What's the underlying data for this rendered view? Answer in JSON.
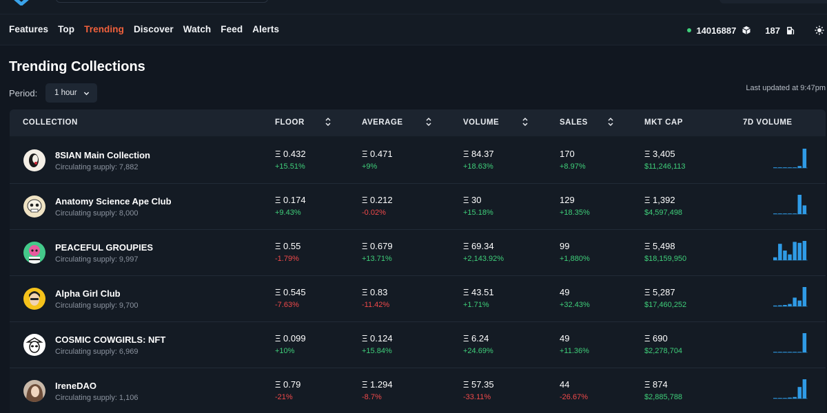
{
  "nav": {
    "items": [
      "Features",
      "Top",
      "Trending",
      "Discover",
      "Watch",
      "Feed",
      "Alerts"
    ],
    "active_index": 2
  },
  "header_stats": {
    "block_number": "14016887",
    "gas": "187"
  },
  "page": {
    "title": "Trending Collections",
    "period_label": "Period:",
    "period_value": "1 hour",
    "last_updated": "Last updated at 9:47pm"
  },
  "table": {
    "columns": {
      "collection": "COLLECTION",
      "floor": "FLOOR",
      "average": "AVERAGE",
      "volume": "VOLUME",
      "sales": "SALES",
      "mkt_cap": "MKT CAP",
      "vol7d": "7D VOLUME"
    },
    "rows": [
      {
        "name": "8SIAN Main Collection",
        "supply": "Circulating supply: 7,882",
        "floor": "Ξ 0.432",
        "floor_chg": "+15.51%",
        "average": "Ξ 0.471",
        "average_chg": "+9%",
        "volume": "Ξ 84.37",
        "volume_chg": "+18.63%",
        "sales": "170",
        "sales_chg": "+8.97%",
        "mktcap": "Ξ 3,405",
        "mktcap_usd": "$11,246,113",
        "spark": [
          0.03,
          0.03,
          0.03,
          0.03,
          0.03,
          0.1,
          1.0
        ],
        "avatar": "portrait-bw"
      },
      {
        "name": "Anatomy Science Ape Club",
        "supply": "Circulating supply: 8,000",
        "floor": "Ξ 0.174",
        "floor_chg": "+9.43%",
        "average": "Ξ 0.212",
        "average_chg": "-0.02%",
        "volume": "Ξ 30",
        "volume_chg": "+15.18%",
        "sales": "129",
        "sales_chg": "+18.35%",
        "mktcap": "Ξ 1,392",
        "mktcap_usd": "$4,597,498",
        "spark": [
          0.03,
          0.03,
          0.03,
          0.03,
          0.03,
          1.0,
          0.45
        ],
        "avatar": "skull-ape"
      },
      {
        "name": "PEACEFUL GROUPIES",
        "supply": "Circulating supply: 9,997",
        "floor": "Ξ 0.55",
        "floor_chg": "-1.79%",
        "average": "Ξ 0.679",
        "average_chg": "+13.71%",
        "volume": "Ξ 69.34",
        "volume_chg": "+2,143.92%",
        "sales": "99",
        "sales_chg": "+1,880%",
        "mktcap": "Ξ 5,498",
        "mktcap_usd": "$18,159,950",
        "spark": [
          0.15,
          0.85,
          0.5,
          0.3,
          0.95,
          0.9,
          1.0
        ],
        "avatar": "groupie"
      },
      {
        "name": "Alpha Girl Club",
        "supply": "Circulating supply: 9,700",
        "floor": "Ξ 0.545",
        "floor_chg": "-7.63%",
        "average": "Ξ 0.83",
        "average_chg": "-11.42%",
        "volume": "Ξ 43.51",
        "volume_chg": "+1.71%",
        "sales": "49",
        "sales_chg": "+32.43%",
        "mktcap": "Ξ 5,287",
        "mktcap_usd": "$17,460,252",
        "spark": [
          0.04,
          0.05,
          0.07,
          0.12,
          0.45,
          0.3,
          1.0
        ],
        "avatar": "girl-yellow"
      },
      {
        "name": "COSMIC COWGIRLS: NFT",
        "supply": "Circulating supply: 6,969",
        "floor": "Ξ 0.099",
        "floor_chg": "+10%",
        "average": "Ξ 0.124",
        "average_chg": "+15.84%",
        "volume": "Ξ 6.24",
        "volume_chg": "+24.69%",
        "sales": "49",
        "sales_chg": "+11.36%",
        "mktcap": "Ξ 690",
        "mktcap_usd": "$2,278,704",
        "spark": [
          0.03,
          0.03,
          0.03,
          0.03,
          0.03,
          0.03,
          1.0
        ],
        "avatar": "cowgirl"
      },
      {
        "name": "IreneDAO",
        "supply": "Circulating supply: 1,106",
        "floor": "Ξ 0.79",
        "floor_chg": "-21%",
        "average": "Ξ 1.294",
        "average_chg": "-8.7%",
        "volume": "Ξ 57.35",
        "volume_chg": "-33.11%",
        "sales": "44",
        "sales_chg": "-26.67%",
        "mktcap": "Ξ 874",
        "mktcap_usd": "$2,885,788",
        "spark": [
          0.03,
          0.03,
          0.03,
          0.05,
          0.08,
          0.6,
          1.0
        ],
        "avatar": "photo"
      }
    ]
  },
  "colors": {
    "accent": "#f2613c",
    "positive": "#3fcf7a",
    "negative": "#f0494a",
    "spark": "#2f9be6"
  }
}
